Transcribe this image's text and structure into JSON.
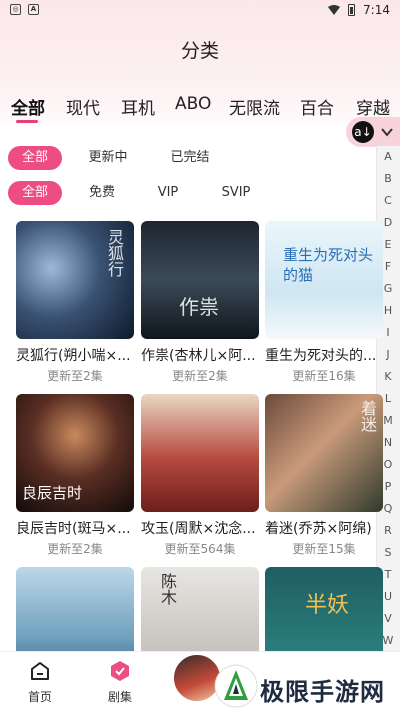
{
  "status_bar": {
    "time": "7:14",
    "left_icons": [
      "notification-icon",
      "app-a-icon"
    ]
  },
  "header": {
    "title": "分类"
  },
  "tabs": [
    {
      "label": "全部",
      "active": true
    },
    {
      "label": "现代",
      "active": false
    },
    {
      "label": "耳机",
      "active": false
    },
    {
      "label": "ABO",
      "active": false
    },
    {
      "label": "无限流",
      "active": false
    },
    {
      "label": "百合",
      "active": false
    },
    {
      "label": "穿越",
      "active": false
    }
  ],
  "status_filters": [
    {
      "label": "全部",
      "active": true
    },
    {
      "label": "更新中",
      "active": false
    },
    {
      "label": "已完结",
      "active": false
    }
  ],
  "price_filters": [
    {
      "label": "全部",
      "active": true
    },
    {
      "label": "免费",
      "active": false
    },
    {
      "label": "VIP",
      "active": false
    },
    {
      "label": "SVIP",
      "active": false
    }
  ],
  "alphabet": [
    "A",
    "B",
    "C",
    "D",
    "E",
    "F",
    "G",
    "H",
    "I",
    "J",
    "K",
    "L",
    "M",
    "N",
    "O",
    "P",
    "Q",
    "R",
    "S",
    "T",
    "U",
    "V",
    "W"
  ],
  "dramas": [
    {
      "name": "灵狐行(朔小喘×...",
      "meta": "更新至2集",
      "cover_text": "灵狐行"
    },
    {
      "name": "作祟(杏林儿×阿...",
      "meta": "更新至2集",
      "cover_text": "作祟"
    },
    {
      "name": "重生为死对头的...",
      "meta": "更新至16集",
      "cover_text": "重生为死对头的猫"
    },
    {
      "name": "良辰吉时(斑马×...",
      "meta": "更新至2集",
      "cover_text": "良辰吉时"
    },
    {
      "name": "攻玉(周默×沈念...",
      "meta": "更新至564集",
      "cover_text": ""
    },
    {
      "name": "着迷(乔苏×阿绵)",
      "meta": "更新至15集",
      "cover_text": "着迷"
    },
    {
      "name": "",
      "meta": "",
      "cover_text": ""
    },
    {
      "name": "",
      "meta": "",
      "cover_text": "陈木"
    },
    {
      "name": "",
      "meta": "",
      "cover_text": "半妖"
    }
  ],
  "bottom_nav": [
    {
      "label": "首页",
      "icon": "home-icon"
    },
    {
      "label": "剧集",
      "icon": "drama-icon"
    }
  ],
  "watermark": {
    "text": "极限手游网"
  },
  "colors": {
    "accent": "#ee4d82",
    "header_bg": "#fbe7ea"
  }
}
